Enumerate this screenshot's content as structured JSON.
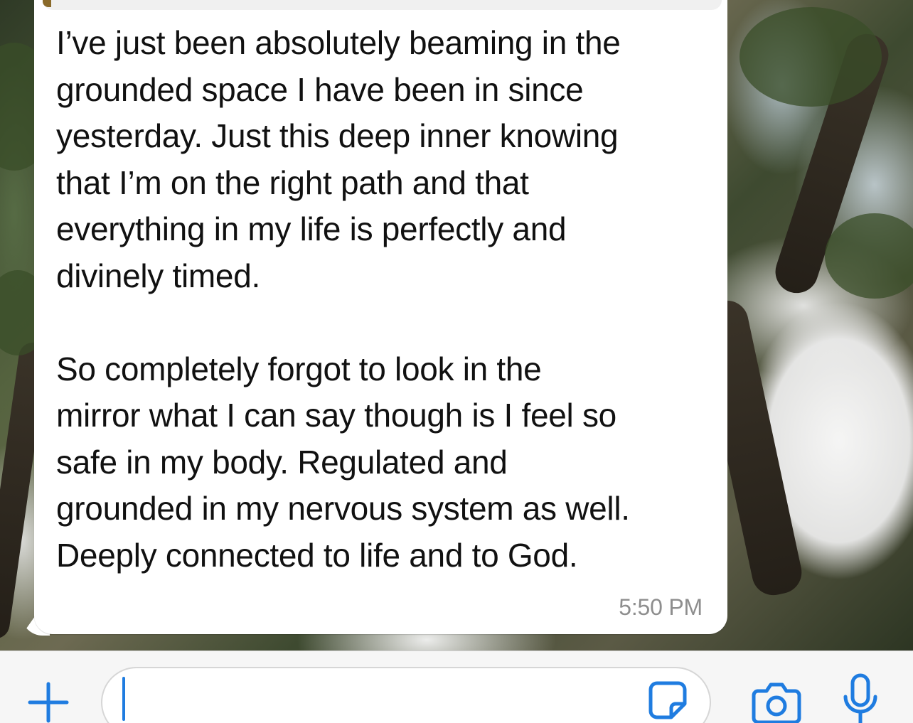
{
  "conversation": {
    "message": {
      "paragraphs": [
        "I’ve just been absolutely beaming in the\ngrounded space I have been in since\nyesterday. Just this deep inner knowing\nthat I’m on the right path and that\neverything in my life is perfectly and\ndivinely timed.",
        "So completely forgot to look in the\nmirror what I can say though is I feel so\nsafe in my body. Regulated and\ngrounded in my nervous system as well.\nDeeply connected to life and to God."
      ],
      "timestamp": "5:50 PM"
    }
  },
  "input_bar": {
    "plus_icon": "plus-icon",
    "text_value": "",
    "sticker_icon": "sticker-icon",
    "camera_icon": "camera-icon",
    "mic_icon": "microphone-icon",
    "accent_color": "#1f7ce0"
  },
  "colors": {
    "bubble": "#ffffff",
    "text": "#111111",
    "timestamp": "#8e8e8e",
    "bar_background": "#f6f6f6"
  }
}
